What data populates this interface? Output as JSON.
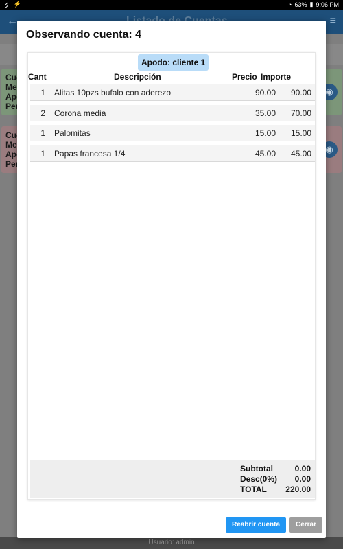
{
  "status_bar": {
    "left_icons": [
      "usb-icon",
      "charging-icon"
    ],
    "battery": "63%",
    "time": "9:06 PM"
  },
  "background": {
    "appbar_title": "Listado de Cuentas",
    "cards": [
      {
        "lines": [
          "Cue",
          "Me",
          "Apo",
          "Per"
        ],
        "color": "green"
      },
      {
        "lines": [
          "Cue",
          "Me",
          "Apo",
          "Per"
        ],
        "color": "red"
      }
    ],
    "footer_text": "Usuario: admin"
  },
  "modal": {
    "title": "Observando cuenta: 4",
    "apodo": "Apodo: cliente 1",
    "columns": {
      "cant": "Cant",
      "descripcion": "Descripción",
      "precio": "Precio",
      "importe": "Importe"
    },
    "items": [
      {
        "cant": "1",
        "descripcion": "Alitas 10pzs bufalo con aderezo",
        "precio": "90.00",
        "importe": "90.00"
      },
      {
        "cant": "2",
        "descripcion": "Corona media",
        "precio": "35.00",
        "importe": "70.00"
      },
      {
        "cant": "1",
        "descripcion": "Palomitas",
        "precio": "15.00",
        "importe": "15.00"
      },
      {
        "cant": "1",
        "descripcion": "Papas francesa 1/4",
        "precio": "45.00",
        "importe": "45.00"
      }
    ],
    "totals": {
      "subtotal_label": "Subtotal",
      "subtotal_value": "0.00",
      "desc_label": "Desc(0%)",
      "desc_value": "0.00",
      "total_label": "TOTAL",
      "total_value": "220.00"
    },
    "buttons": {
      "reopen": "Reabrir cuenta",
      "close": "Cerrar"
    }
  },
  "colors": {
    "primary": "#2196f3",
    "apodo_bg": "#b9dcf8",
    "secondary_button": "#9e9e9e"
  }
}
